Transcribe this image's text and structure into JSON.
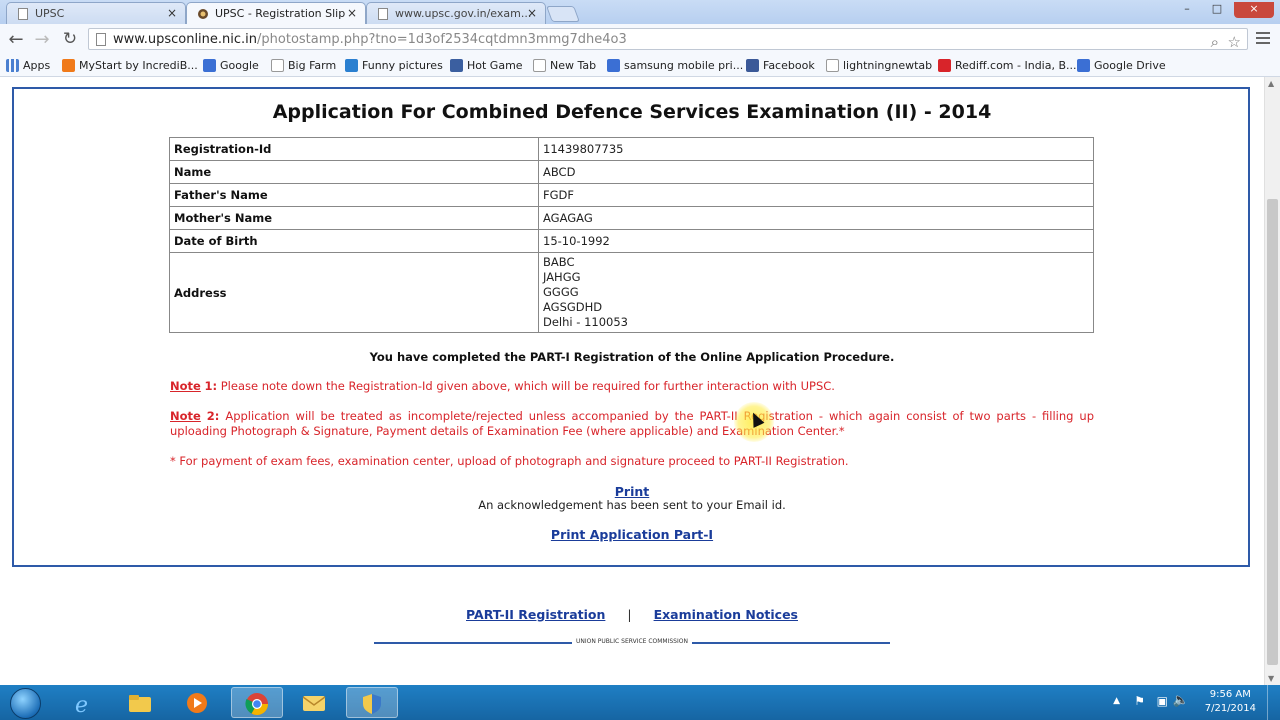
{
  "browser": {
    "tabs": [
      {
        "label": "UPSC",
        "active": false
      },
      {
        "label": "UPSC - Registration Slip",
        "active": true
      },
      {
        "label": "www.upsc.gov.in/exam...",
        "active": false
      }
    ],
    "close_glyph": "×",
    "url_domain": "www.upsconline.nic.in",
    "url_path": "/photostamp.php?tno=1d3of2534cqtdmn3mmg7dhe4o3",
    "window_controls": {
      "minimize": "–",
      "maximize": "□",
      "close": "×"
    },
    "bookmarks": [
      {
        "label": "Apps",
        "color": "#4a7fd0"
      },
      {
        "label": "MyStart by IncrediB...",
        "color": "#f07a1a"
      },
      {
        "label": "Google",
        "color": "#3b6fd4"
      },
      {
        "label": "Big Farm",
        "color": "#ffffff"
      },
      {
        "label": "Funny pictures",
        "color": "#2a7fd0"
      },
      {
        "label": "Hot Game",
        "color": "#3b5fa0"
      },
      {
        "label": "New Tab",
        "color": "#ffffff"
      },
      {
        "label": "samsung mobile pri...",
        "color": "#3b6fd4"
      },
      {
        "label": "Facebook",
        "color": "#3b5998"
      },
      {
        "label": "lightningnewtab",
        "color": "#ffffff"
      },
      {
        "label": "Rediff.com - India, B...",
        "color": "#d8242a"
      },
      {
        "label": "Google Drive",
        "color": "#3b6fd4"
      }
    ]
  },
  "page": {
    "title": "Application For Combined Defence Services Examination (II) - 2014",
    "rows": [
      {
        "label": "Registration-Id",
        "value": "11439807735"
      },
      {
        "label": "Name",
        "value": "ABCD"
      },
      {
        "label": "Father's Name",
        "value": "FGDF"
      },
      {
        "label": "Mother's Name",
        "value": "AGAGAG"
      },
      {
        "label": "Date of Birth",
        "value": "15-10-1992"
      }
    ],
    "address": {
      "label": "Address",
      "lines": [
        "BABC",
        "JAHGG",
        "GGGG",
        "AGSGDHD",
        "Delhi - 110053"
      ]
    },
    "completed_msg": "You have completed the PART-I Registration of the Online Application Procedure.",
    "note1": {
      "label": "Note",
      "num": "1:",
      "text": " Please note down the Registration-Id given above, which will be required for further interaction with UPSC."
    },
    "note2": {
      "label": "Note",
      "num": "2:",
      "text": " Application will be treated as incomplete/rejected unless accompanied by the PART-II Registration - which again consist of two parts - filling up uploading Photograph & Signature, Payment details of Examination Fee (where applicable) and Examination Center.*"
    },
    "note3": "* For payment of exam fees, examination center, upload of photograph and signature proceed to PART-II Registration.",
    "print_label": "Print",
    "ack_msg": "An acknowledgement has been sent to your Email id.",
    "print_part1_label": "Print Application Part-I",
    "footer": {
      "part2_label": "PART-II Registration",
      "separator": "|",
      "notices_label": "Examination Notices",
      "rule_text": "UNION PUBLIC SERVICE COMMISSION"
    }
  },
  "taskbar": {
    "time": "9:56 AM",
    "date": "7/21/2014"
  }
}
